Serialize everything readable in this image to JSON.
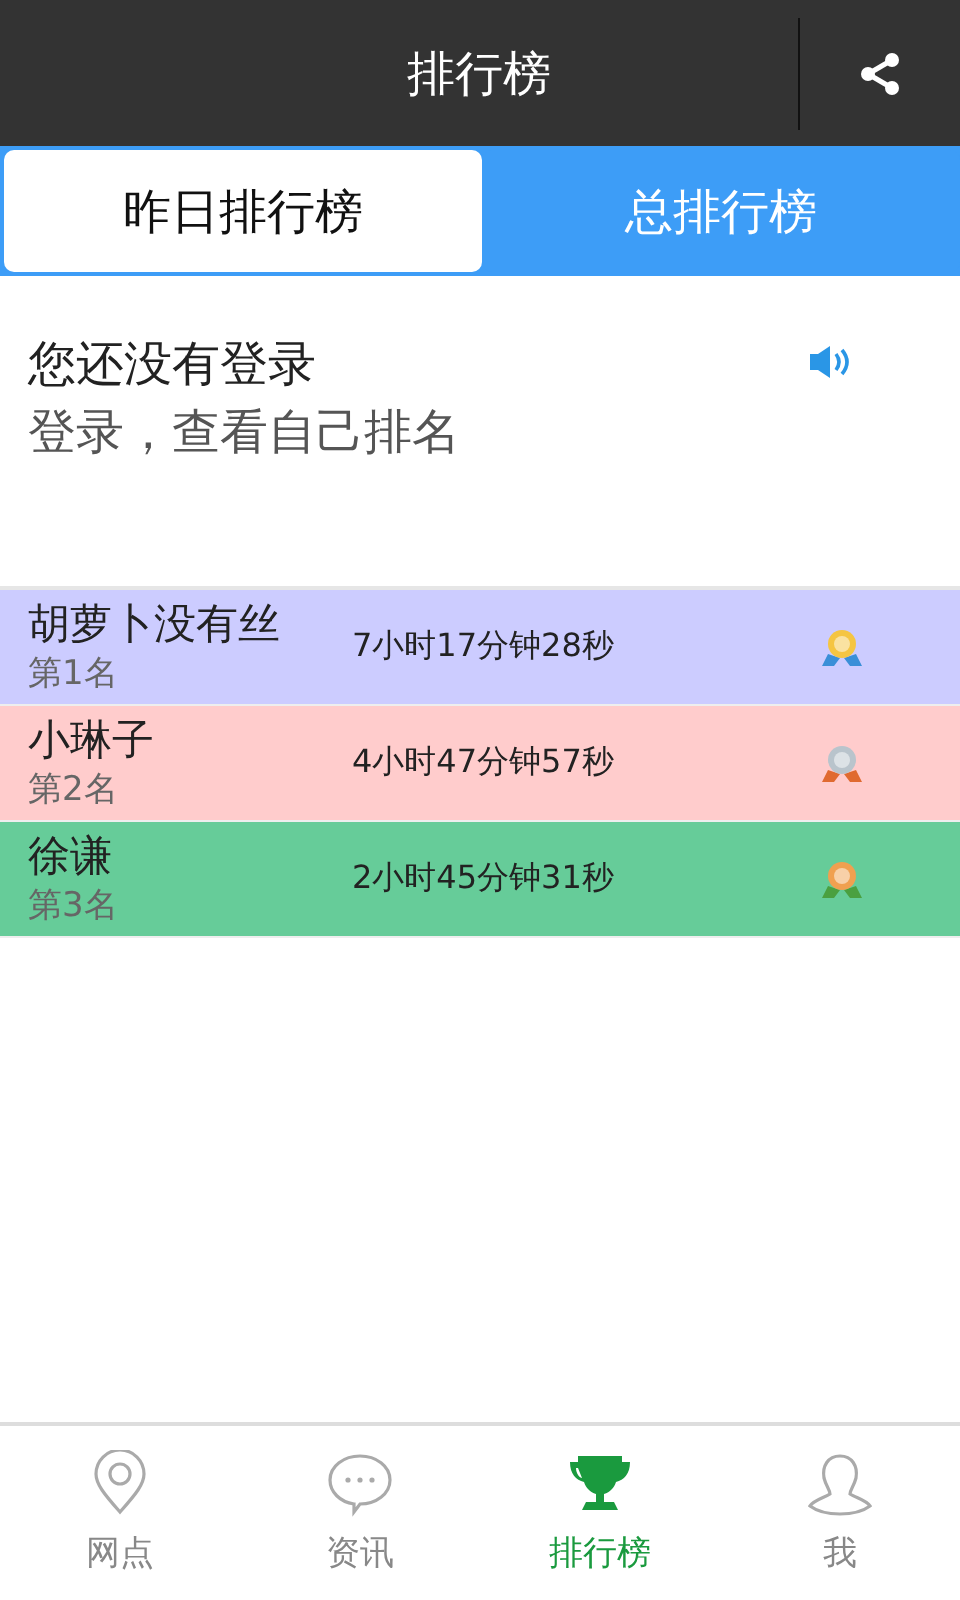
{
  "header": {
    "title": "排行榜"
  },
  "tabs": [
    {
      "label": "昨日排行榜",
      "selected": true
    },
    {
      "label": "总排行榜",
      "selected": false
    }
  ],
  "login_notice": {
    "title": "您还没有登录",
    "subtitle": "登录，查看自己排名"
  },
  "ranking": [
    {
      "name": "胡萝卜没有丝",
      "rank": "第1名",
      "time": "7小时17分钟28秒",
      "color": "#ccccff",
      "kind": "gold"
    },
    {
      "name": "小琳子",
      "rank": "第2名",
      "time": "4小时47分钟57秒",
      "color": "#ffcccc",
      "kind": "silver"
    },
    {
      "name": "徐谦",
      "rank": "第3名",
      "time": "2小时45分钟31秒",
      "color": "#66cc99",
      "kind": "bronze"
    }
  ],
  "bottom_nav": [
    {
      "label": "网点",
      "kind": "location",
      "selected": false
    },
    {
      "label": "资讯",
      "kind": "chat",
      "selected": false
    },
    {
      "label": "排行榜",
      "kind": "trophy",
      "selected": true
    },
    {
      "label": "我",
      "kind": "person",
      "selected": false
    }
  ]
}
